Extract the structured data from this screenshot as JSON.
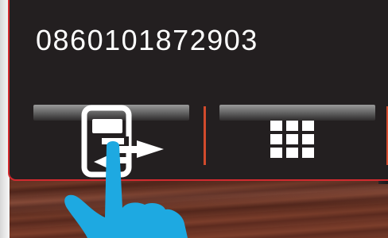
{
  "call": {
    "phone_number": "0860101872903"
  },
  "buttons": {
    "transfer_icon": "call-transfer-icon",
    "keypad_icon": "keypad-grid-icon"
  },
  "overlay": {
    "pointer_icon": "pointing-hand-icon"
  },
  "colors": {
    "panel_background": "#231f20",
    "panel_border": "#d22a2f",
    "divider": "#d14a2c",
    "hand": "#1ea9e1",
    "text": "#ffffff"
  }
}
